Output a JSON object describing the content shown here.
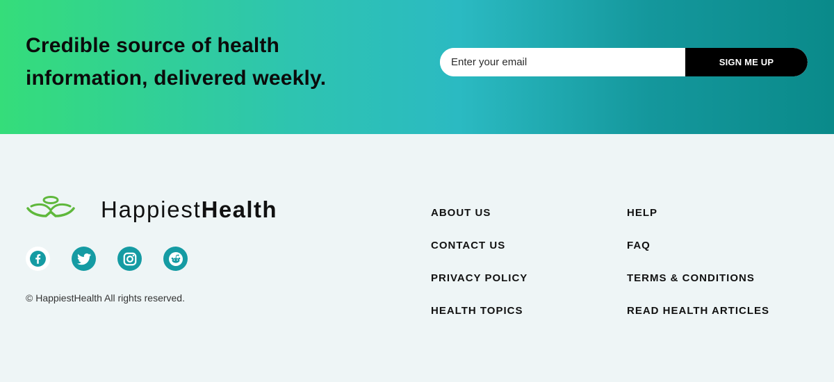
{
  "newsletter": {
    "title_line1": "Credible source of health",
    "title_line2": "information, delivered weekly.",
    "email_placeholder": "Enter your email",
    "submit_label": "SIGN ME UP"
  },
  "brand": {
    "name_light": "Happiest",
    "name_bold": "Health",
    "logo_color": "#5fb83c"
  },
  "social": [
    {
      "icon": "facebook-icon"
    },
    {
      "icon": "twitter-icon"
    },
    {
      "icon": "instagram-icon"
    },
    {
      "icon": "reddit-icon"
    }
  ],
  "copyright": "© HappiestHealth All rights reserved.",
  "links": {
    "col1": [
      "ABOUT US",
      "CONTACT US",
      "PRIVACY POLICY",
      "HEALTH TOPICS"
    ],
    "col2": [
      "HELP",
      "FAQ",
      "TERMS & CONDITIONS",
      "READ HEALTH ARTICLES"
    ]
  },
  "colors": {
    "accent": "#159ba3",
    "button": "#000000"
  }
}
